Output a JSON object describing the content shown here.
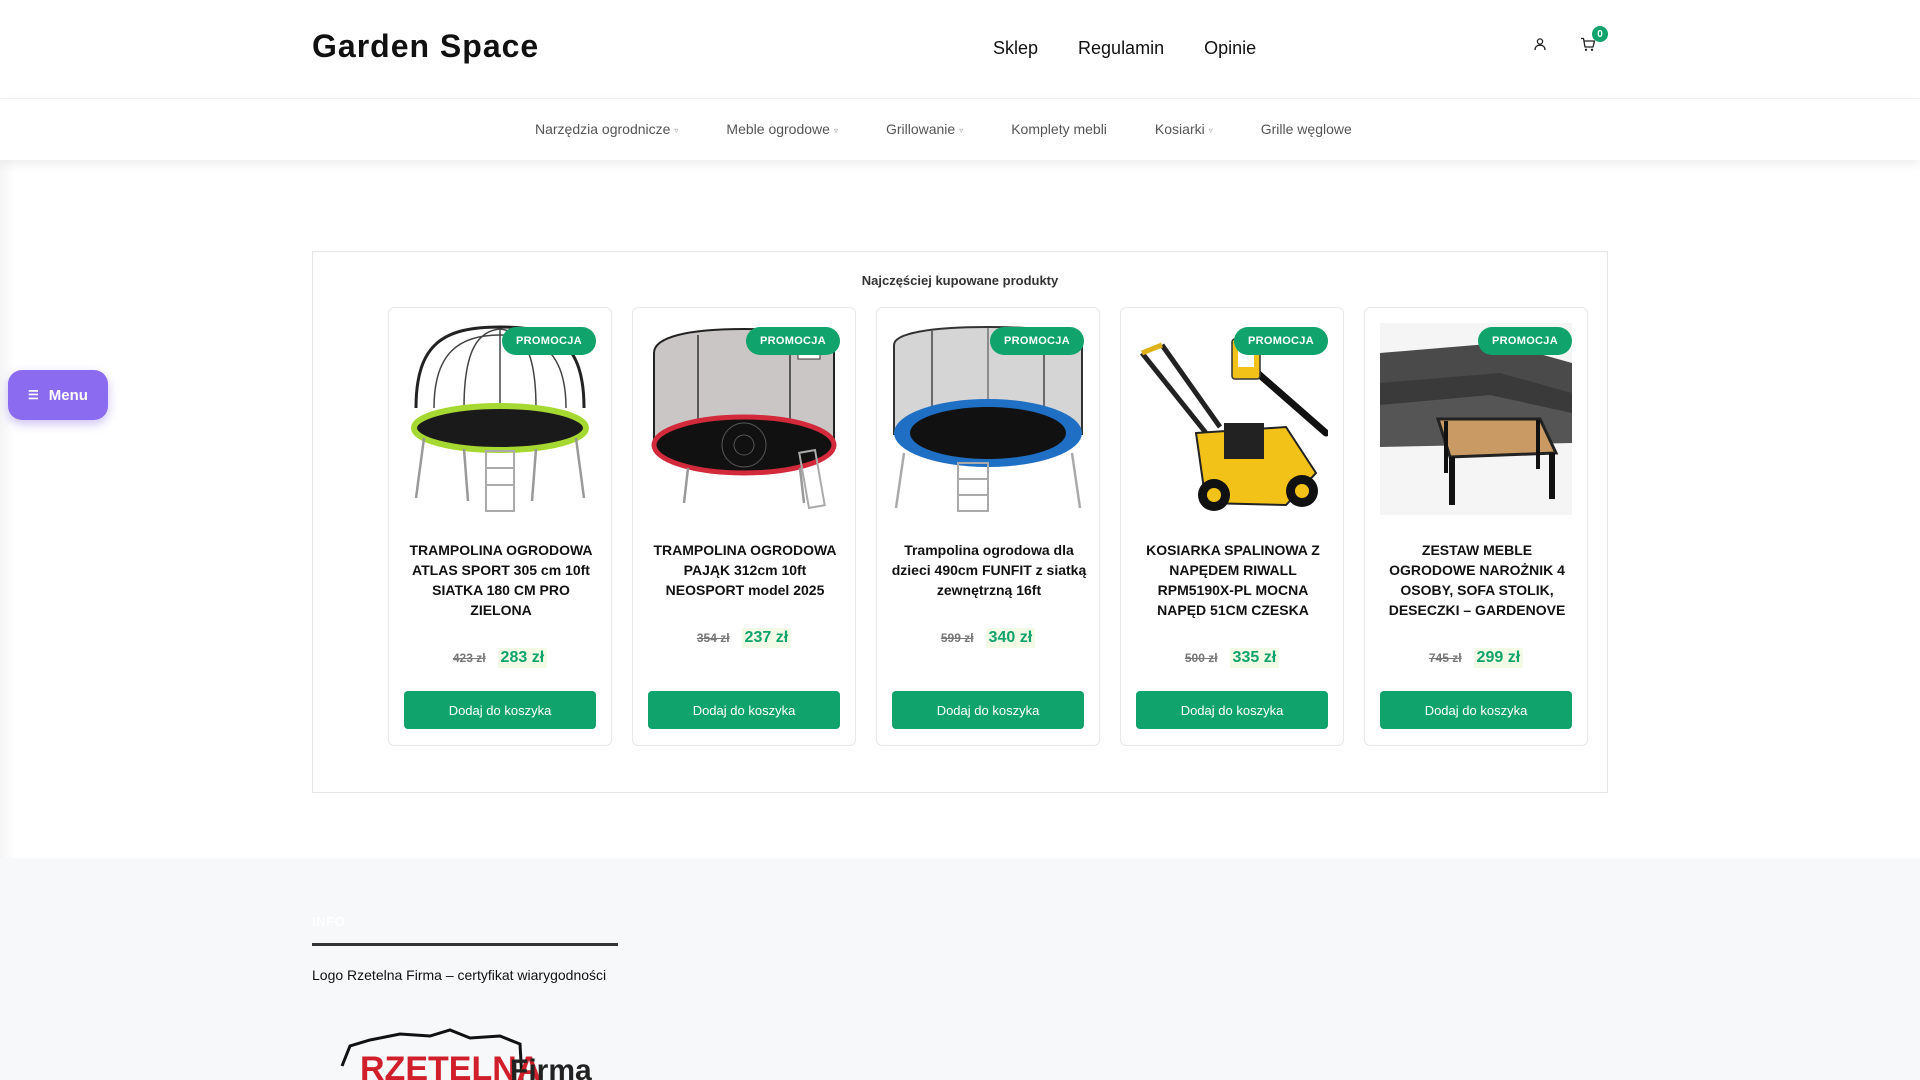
{
  "header": {
    "brand": "Garden Space",
    "nav": [
      "Sklep",
      "Regulamin",
      "Opinie"
    ],
    "cart_count": "0",
    "icons": [
      "user-icon",
      "cart-icon"
    ]
  },
  "categories": [
    {
      "label": "Narzędzia ogrodnicze",
      "has_dropdown": true
    },
    {
      "label": "Meble ogrodowe",
      "has_dropdown": true
    },
    {
      "label": "Grillowanie",
      "has_dropdown": true
    },
    {
      "label": "Komplety mebli",
      "has_dropdown": false
    },
    {
      "label": "Kosiarki",
      "has_dropdown": true
    },
    {
      "label": "Grille węglowe",
      "has_dropdown": false
    }
  ],
  "floating_menu": {
    "label": "Menu",
    "icon": "hamburger-icon"
  },
  "products": {
    "title": "Najczęściej kupowane produkty",
    "items": [
      {
        "badge": "PROMOCJA",
        "name": "TRAMPOLINA OGRODOWA ATLAS SPORT 305 cm 10ft SIATKA 180 CM PRO ZIELONA",
        "old_price": "423 zł",
        "new_price": "283 zł",
        "button": "Dodaj do koszyka",
        "image": "trampoline-green"
      },
      {
        "badge": "PROMOCJA",
        "name": "TRAMPOLINA OGRODOWA PAJĄK 312cm 10ft NEOSPORT model 2025",
        "old_price": "354 zł",
        "new_price": "237 zł",
        "button": "Dodaj do koszyka",
        "image": "trampoline-red"
      },
      {
        "badge": "PROMOCJA",
        "name": "Trampolina ogrodowa dla dzieci 490cm FUNFIT z siatką zewnętrzną 16ft",
        "old_price": "599 zł",
        "new_price": "340 zł",
        "button": "Dodaj do koszyka",
        "image": "trampoline-blue"
      },
      {
        "badge": "PROMOCJA",
        "name": "KOSIARKA SPALINOWA Z NAPĘDEM RIWALL RPM5190X-PL MOCNA NAPĘD 51CM CZESKA",
        "old_price": "500 zł",
        "new_price": "335 zł",
        "button": "Dodaj do koszyka",
        "image": "lawn-mower"
      },
      {
        "badge": "PROMOCJA",
        "name": "ZESTAW MEBLE OGRODOWE NAROŻNIK 4 OSOBY, SOFA STOLIK, DESECZKI – GARDENOVE",
        "old_price": "745 zł",
        "new_price": "299 zł",
        "button": "Dodaj do koszyka",
        "image": "garden-sofa-set"
      }
    ]
  },
  "footer": {
    "heading": "INFO",
    "text": "Logo Rzetelna Firma – certyfikat wiarygodności",
    "logo_text": "RZETELNA Firma"
  },
  "colors": {
    "accent": "#10a36b",
    "menu": "#8b6cf0",
    "price_bg": "#f3fbe6"
  }
}
